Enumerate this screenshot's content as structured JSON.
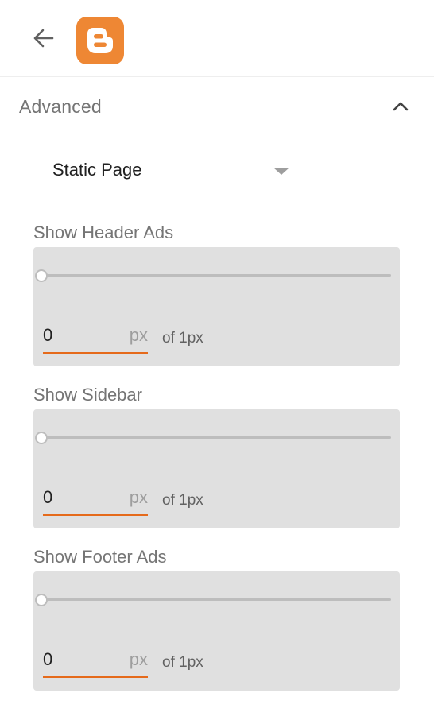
{
  "header": {
    "back_icon": "arrow-left-icon",
    "logo_icon": "blogger-logo-icon",
    "brand_color": "#ee8734"
  },
  "section": {
    "title": "Advanced",
    "expanded": true,
    "chevron_icon": "chevron-up-icon"
  },
  "dropdown": {
    "value": "Static Page",
    "arrow_icon": "triangle-down-icon"
  },
  "settings": [
    {
      "label": "Show Header Ads",
      "slider_value": 0,
      "slider_max": 1,
      "value": "0",
      "unit": "px",
      "of_text": "of 1px"
    },
    {
      "label": "Show Sidebar",
      "slider_value": 0,
      "slider_max": 1,
      "value": "0",
      "unit": "px",
      "of_text": "of 1px"
    },
    {
      "label": "Show Footer Ads",
      "slider_value": 0,
      "slider_max": 1,
      "value": "0",
      "unit": "px",
      "of_text": "of 1px"
    }
  ],
  "colors": {
    "accent": "#e56a1b",
    "panel_bg": "#e0e0e0",
    "label": "#757575"
  }
}
